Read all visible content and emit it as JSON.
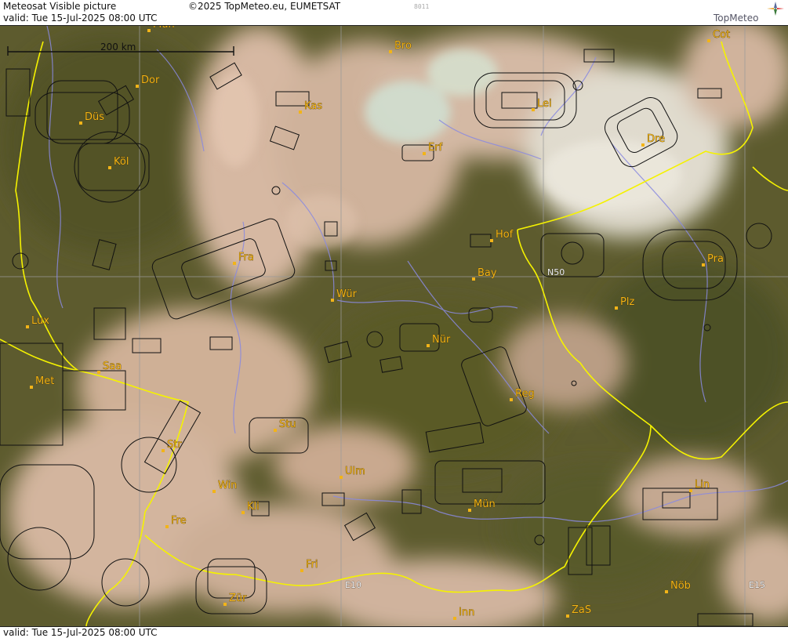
{
  "header": {
    "title": "Meteosat Visible picture",
    "valid": "valid:  Tue  15-Jul-2025  08:00 UTC",
    "copyright": "©2025 TopMeteo.eu, EUMETSAT",
    "code": "8011",
    "logo_text": "TopMeteo"
  },
  "footer": {
    "valid": "valid:  Tue  15-Jul-2025  08:00 UTC"
  },
  "map": {
    "scale_label": "200 km",
    "grid_labels": {
      "n50": "N50",
      "e10": "E10",
      "e15": "E15"
    },
    "cities": [
      {
        "id": "mun-top",
        "label": "Mün"
      },
      {
        "id": "bro",
        "label": "Bro"
      },
      {
        "id": "cot",
        "label": "Cot"
      },
      {
        "id": "dor",
        "label": "Dor"
      },
      {
        "id": "kas",
        "label": "Kas"
      },
      {
        "id": "lei",
        "label": "Lei"
      },
      {
        "id": "dus",
        "label": "Düs"
      },
      {
        "id": "erf",
        "label": "Erf"
      },
      {
        "id": "dre",
        "label": "Dre"
      },
      {
        "id": "kol",
        "label": "Köl"
      },
      {
        "id": "hof",
        "label": "Hof"
      },
      {
        "id": "fra",
        "label": "Fra"
      },
      {
        "id": "pra",
        "label": "Pra"
      },
      {
        "id": "bay",
        "label": "Bay"
      },
      {
        "id": "wur",
        "label": "Wür"
      },
      {
        "id": "plz",
        "label": "Plz"
      },
      {
        "id": "lux",
        "label": "Lux"
      },
      {
        "id": "nur",
        "label": "Nür"
      },
      {
        "id": "saa",
        "label": "Saa"
      },
      {
        "id": "met",
        "label": "Met"
      },
      {
        "id": "reg",
        "label": "Reg"
      },
      {
        "id": "stu",
        "label": "Stu"
      },
      {
        "id": "str",
        "label": "Str"
      },
      {
        "id": "ulm",
        "label": "Ulm"
      },
      {
        "id": "win",
        "label": "Win"
      },
      {
        "id": "lin",
        "label": "Lin"
      },
      {
        "id": "kli",
        "label": "Kli"
      },
      {
        "id": "mun",
        "label": "Mün"
      },
      {
        "id": "fre",
        "label": "Fre"
      },
      {
        "id": "fri",
        "label": "Fri"
      },
      {
        "id": "nob",
        "label": "Nöb"
      },
      {
        "id": "zur",
        "label": "Zür"
      },
      {
        "id": "zas",
        "label": "ZaS"
      },
      {
        "id": "inn",
        "label": "Inn"
      }
    ]
  },
  "colors": {
    "border": "#f5f200",
    "rivers": "#8a8ae0",
    "airspace": "#111111",
    "city": "#f2b418",
    "forest": "#5c5a2c",
    "cloud": "#d9bfa8"
  }
}
